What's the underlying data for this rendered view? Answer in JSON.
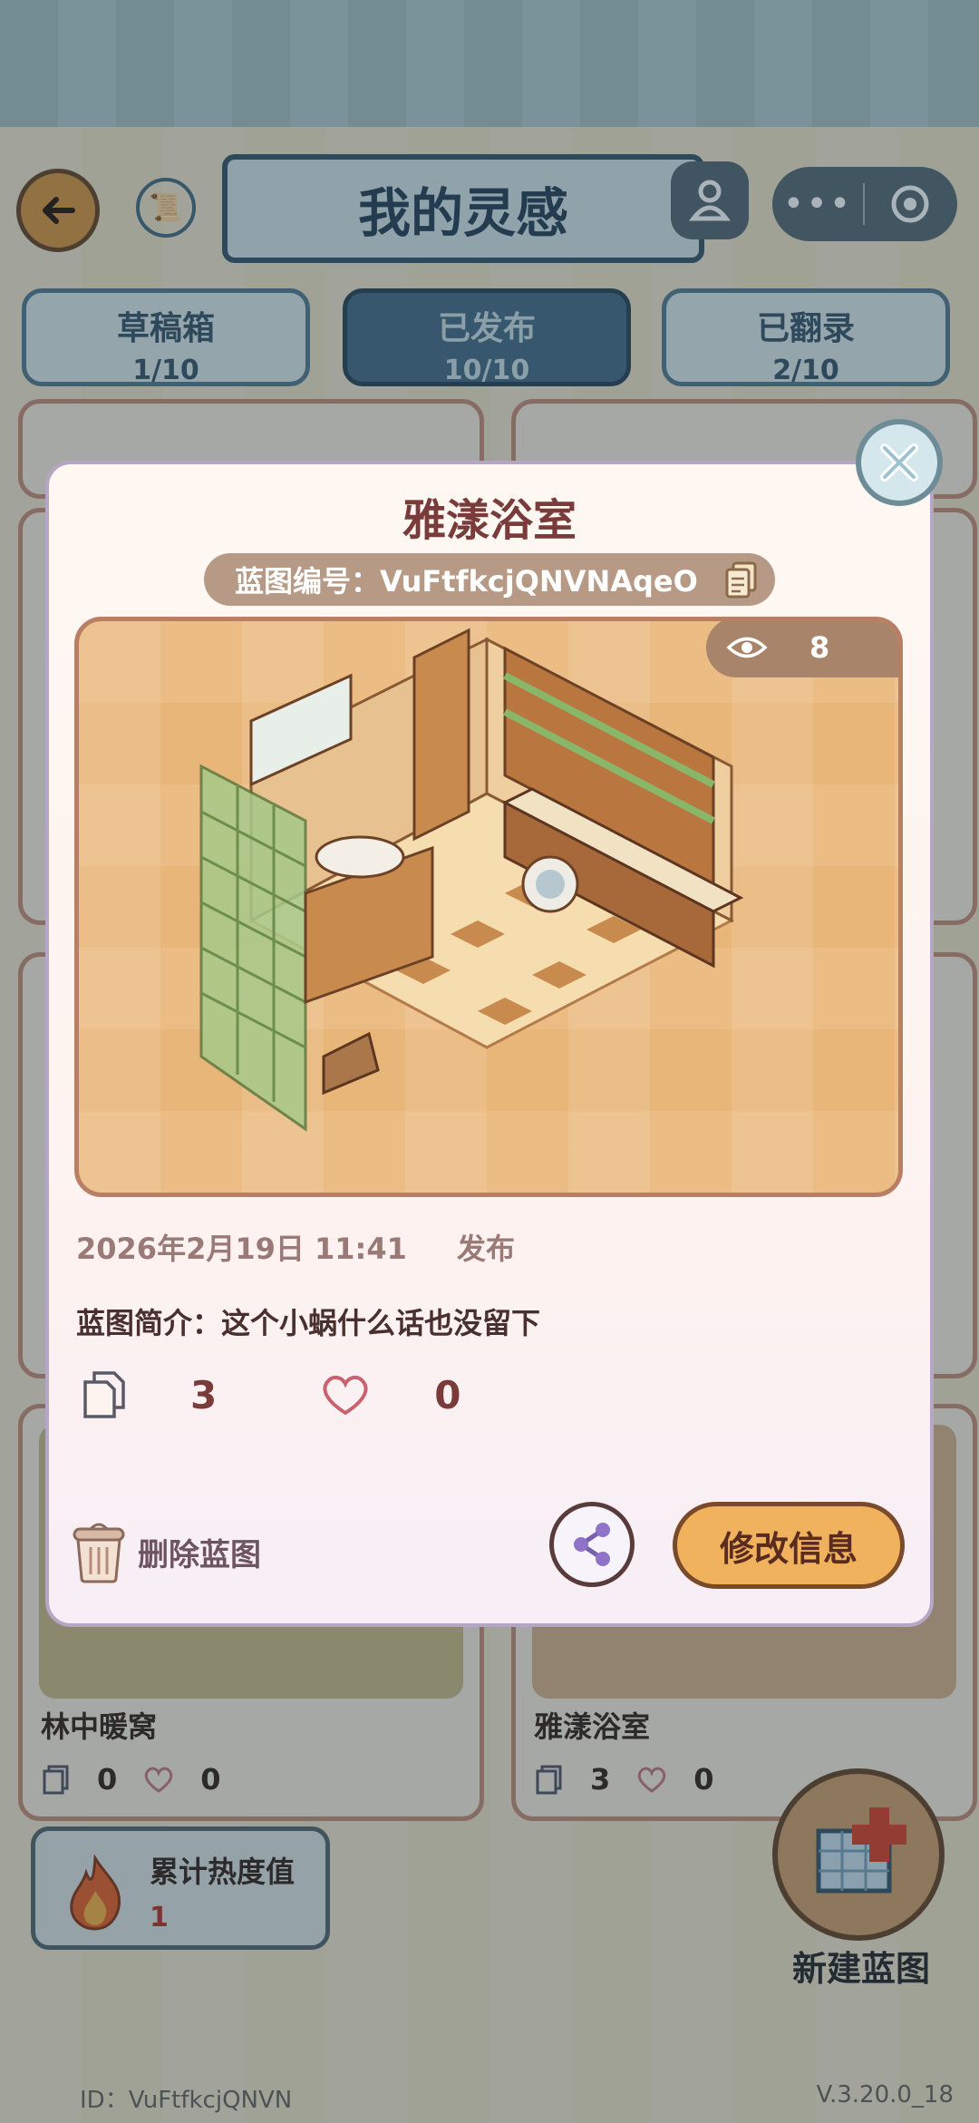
{
  "header": {
    "title": "我的灵感"
  },
  "tabs": [
    {
      "label": "草稿箱",
      "count": "1/10"
    },
    {
      "label": "已发布",
      "count": "10/10"
    },
    {
      "label": "已翻录",
      "count": "2/10"
    }
  ],
  "cards": [
    {
      "name": "林中暖窝",
      "copies": "0",
      "likes": "0"
    },
    {
      "name": "雅漾浴室",
      "copies": "3",
      "likes": "0"
    }
  ],
  "heat": {
    "label": "累计热度值",
    "value": "1"
  },
  "new_blueprint": {
    "label": "新建蓝图"
  },
  "footer": {
    "id": "ID：VuFtfkcjQNVN",
    "version": "V.3.20.0_18"
  },
  "modal": {
    "title": "雅漾浴室",
    "code_label": "蓝图编号：VuFtfkcjQNVNAqeO",
    "views": "8",
    "date": "2026年2月19日 11:41",
    "status": "发布",
    "description": "蓝图简介：这个小蜗什么话也没留下",
    "copies": "3",
    "likes": "0",
    "delete_label": "删除蓝图",
    "edit_label": "修改信息"
  },
  "icons": [
    "back-arrow-icon",
    "scroll-icon",
    "avatar-icon",
    "more-icon",
    "target-icon",
    "close-icon",
    "copy-icon",
    "eye-icon",
    "heart-icon",
    "trash-icon",
    "share-icon",
    "flame-icon",
    "blueprint-add-icon"
  ],
  "colors": {
    "accent": "#f1b25d",
    "title": "#7a3b3b",
    "tab_active": "#4a6f89"
  }
}
